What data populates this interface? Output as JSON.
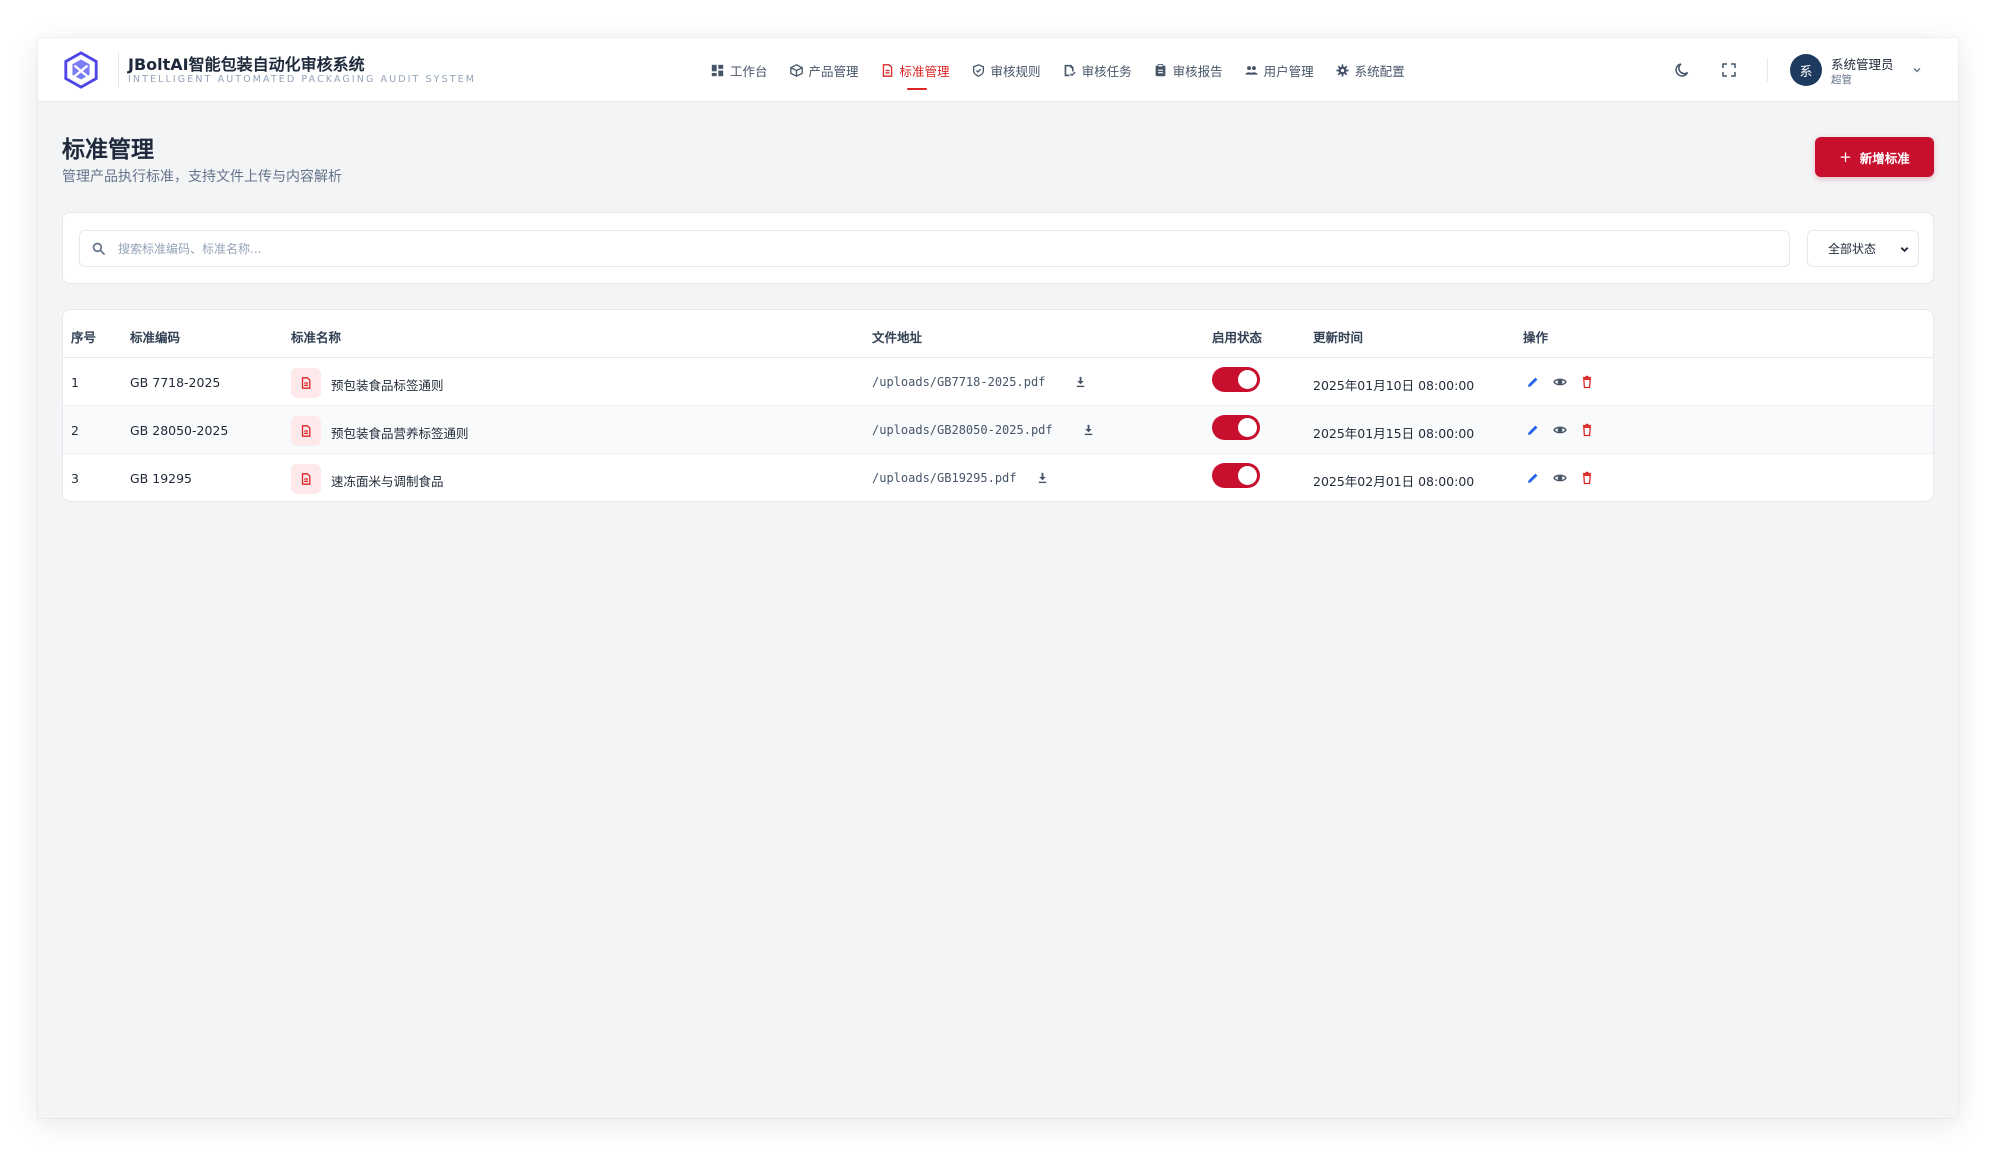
{
  "app": {
    "title": "JBoltAI智能包装自动化审核系统",
    "subtitle": "INTELLIGENT AUTOMATED PACKAGING AUDIT SYSTEM"
  },
  "nav": [
    {
      "label": "工作台",
      "icon": "dashboard-icon",
      "active": false
    },
    {
      "label": "产品管理",
      "icon": "box-icon",
      "active": false
    },
    {
      "label": "标准管理",
      "icon": "document-icon",
      "active": true
    },
    {
      "label": "审核规则",
      "icon": "shield-icon",
      "active": false
    },
    {
      "label": "审核任务",
      "icon": "task-icon",
      "active": false
    },
    {
      "label": "审核报告",
      "icon": "clipboard-icon",
      "active": false
    },
    {
      "label": "用户管理",
      "icon": "users-icon",
      "active": false
    },
    {
      "label": "系统配置",
      "icon": "gear-icon",
      "active": false
    }
  ],
  "user": {
    "avatar_text": "系",
    "name": "系统管理员",
    "role": "超管"
  },
  "page": {
    "title": "标准管理",
    "subtitle": "管理产品执行标准，支持文件上传与内容解析",
    "add_button": "新增标准"
  },
  "search": {
    "placeholder": "搜索标准编码、标准名称...",
    "value": ""
  },
  "status_filter": {
    "selected": "全部状态"
  },
  "table": {
    "headers": {
      "index": "序号",
      "code": "标准编码",
      "name": "标准名称",
      "path": "文件地址",
      "status": "启用状态",
      "updated": "更新时间",
      "actions": "操作"
    },
    "rows": [
      {
        "index": "1",
        "code": "GB 7718-2025",
        "name": "预包装食品标签通则",
        "path": "/uploads/GB7718-2025.pdf",
        "enabled": true,
        "updated": "2025年01月10日 08:00:00"
      },
      {
        "index": "2",
        "code": "GB 28050-2025",
        "name": "预包装食品营养标签通则",
        "path": "/uploads/GB28050-2025.pdf",
        "enabled": true,
        "updated": "2025年01月15日 08:00:00"
      },
      {
        "index": "3",
        "code": "GB 19295",
        "name": "速冻面米与调制食品",
        "path": "/uploads/GB19295.pdf",
        "enabled": true,
        "updated": "2025年02月01日 08:00:00"
      }
    ]
  },
  "colors": {
    "accent": "#c8102e",
    "brand": "#4f46e5",
    "avatar": "#1e3a5f",
    "edit": "#2563eb"
  }
}
